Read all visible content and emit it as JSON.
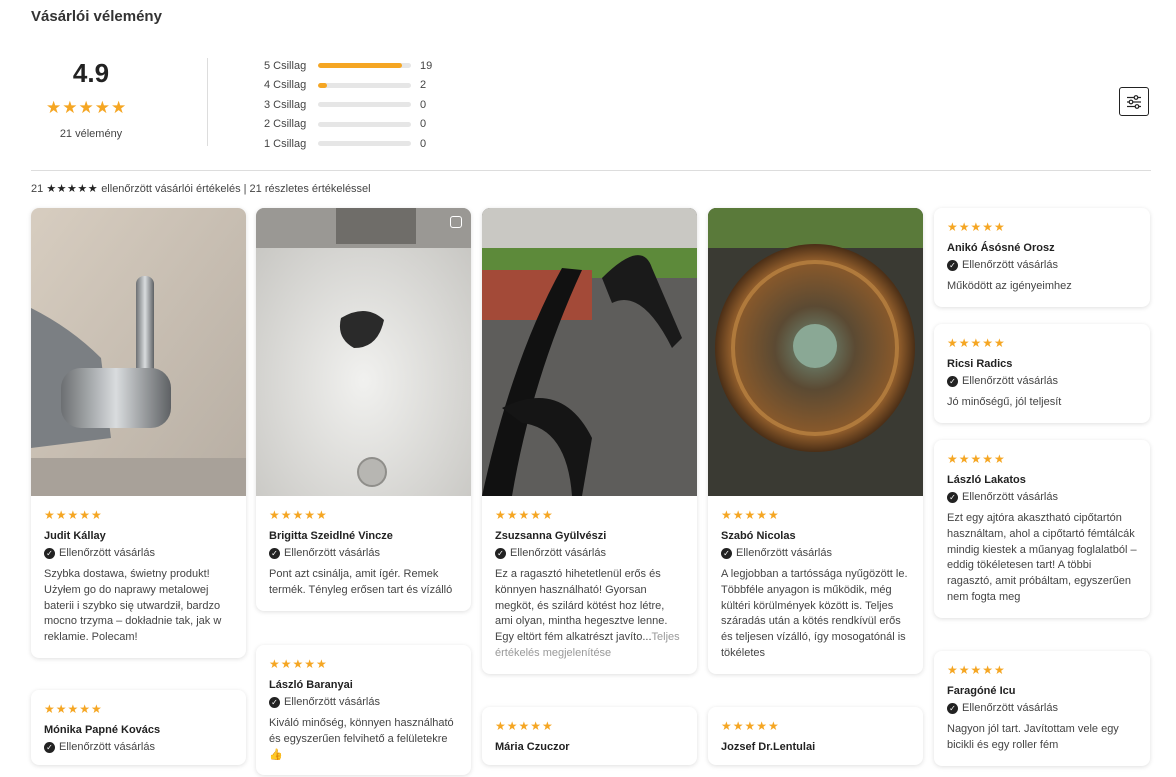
{
  "header": {
    "title": "Vásárlói vélemény"
  },
  "summary": {
    "score": "4.9",
    "stars": "★★★★★",
    "count": "21 vélemény"
  },
  "histogram": [
    {
      "label": "5 Csillag",
      "count": "19",
      "fraction": 0.905
    },
    {
      "label": "4 Csillag",
      "count": "2",
      "fraction": 0.095
    },
    {
      "label": "3 Csillag",
      "count": "0",
      "fraction": 0
    },
    {
      "label": "2 Csillag",
      "count": "0",
      "fraction": 0
    },
    {
      "label": "1 Csillag",
      "count": "0",
      "fraction": 0
    }
  ],
  "filter": {
    "icon": "sliders-icon"
  },
  "verified_line": {
    "count": "21",
    "stars": "★★★★★",
    "text": "ellenőrzött vásárlói értékelés | 21 részletes értékeléssel"
  },
  "verified_label": "Ellenőrzött vásárlás",
  "stars": "★★★★★",
  "colors": {
    "accent": "#f5a623",
    "text": "#222222",
    "muted": "#444444"
  },
  "reviews": [
    {
      "name": "Judit Kállay",
      "text": "Szybka dostawa, świetny produkt! Użyłem go do naprawy metalowej baterii i szybko się utwardził, bardzo mocno trzyma – dokładnie tak, jak w reklamie. Polecam!"
    },
    {
      "name": "Mónika Papné Kovács",
      "text": ""
    },
    {
      "name": "Brigitta Szeidlné Vincze",
      "text": "Pont azt csinálja, amit ígér. Remek termék. Tényleg erősen tart és vízálló"
    },
    {
      "name": "László Baranyai",
      "text": "Kiváló minőség, könnyen használható és egyszerűen felvihető a felületekre 👍"
    },
    {
      "name": "Zsuzsanna Gyülvészi",
      "text": "Ez a ragasztó hihetetlenül erős és könnyen használható! Gyorsan megköt, és szilárd kötést hoz létre, ami olyan, mintha hegesztve lenne. Egy eltört fém alkatrészt javíto...",
      "more": "Teljes értékelés megjelenítése"
    },
    {
      "name": "Mária Czuczor",
      "text": ""
    },
    {
      "name": "Szabó Nicolas",
      "text": "A legjobban a tartóssága nyűgözött le. Többféle anyagon is működik, még kültéri körülmények között is. Teljes száradás után a kötés rendkívül erős és teljesen vízálló, így mosogatónál is tökéletes"
    },
    {
      "name": "Jozsef Dr.Lentulai",
      "text": ""
    },
    {
      "name": "Anikó Ásósné Orosz",
      "text": "Működött az igényeimhez"
    },
    {
      "name": "Ricsi Radics",
      "text": "Jó minőségű, jól teljesít"
    },
    {
      "name": "László Lakatos",
      "text": "Ezt egy ajtóra akasztható cipőtartón használtam, ahol a cipőtartó fémtálcák mindig kiestek a műanyag foglalatból – eddig tökéletesen tart! A többi ragasztó, amit próbáltam, egyszerűen nem fogta meg"
    },
    {
      "name": "Faragóné Icu",
      "text": "Nagyon jól tart. Javítottam vele egy bicikli és egy roller fém"
    }
  ]
}
